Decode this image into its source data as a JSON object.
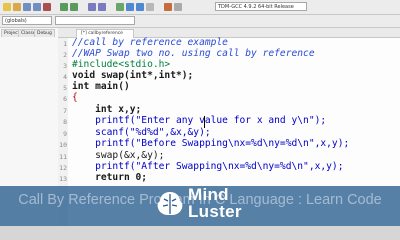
{
  "toolbar": {
    "compiler_select": "TDM-GCC 4.9.2 64-bit Release",
    "scope_select": "(globals)"
  },
  "left_panel": {
    "tabs": [
      "Project",
      "Classes",
      "Debug"
    ]
  },
  "editor": {
    "active_tab": "[*] callbyreference",
    "lines": [
      {
        "n": "1",
        "text": "//call by reference example"
      },
      {
        "n": "2",
        "text": "//WAP Swap two no. using call by reference"
      },
      {
        "n": "3",
        "text": "#include<stdio.h>"
      },
      {
        "n": "4",
        "text": "void swap(int*,int*);"
      },
      {
        "n": "5",
        "text": "int main()"
      },
      {
        "n": "6",
        "text": "{"
      },
      {
        "n": "7",
        "text": "    int x,y;"
      },
      {
        "n": "8",
        "text": "    printf(\"Enter any value for x and y\\n\");"
      },
      {
        "n": "9",
        "text": "    scanf(\"%d%d\",&x,&y);"
      },
      {
        "n": "10",
        "text": "    printf(\"Before Swapping\\nx=%d\\ny=%d\\n\",x,y);"
      },
      {
        "n": "11",
        "text": "    swap(&x,&y);"
      },
      {
        "n": "12",
        "text": "    printf(\"After Swapping\\nx=%d\\ny=%d\\n\",x,y);"
      },
      {
        "n": "13",
        "text": "    return 0;"
      }
    ]
  },
  "banner": {
    "caption": "Call By Reference Program In C Language : Learn Code",
    "brand_line1": "Mind",
    "brand_line2": "Luster"
  },
  "colors": {
    "banner": "#285c8e",
    "comment": "#2b4ad8",
    "string": "#0000c8",
    "preprocessor": "#00813e"
  }
}
